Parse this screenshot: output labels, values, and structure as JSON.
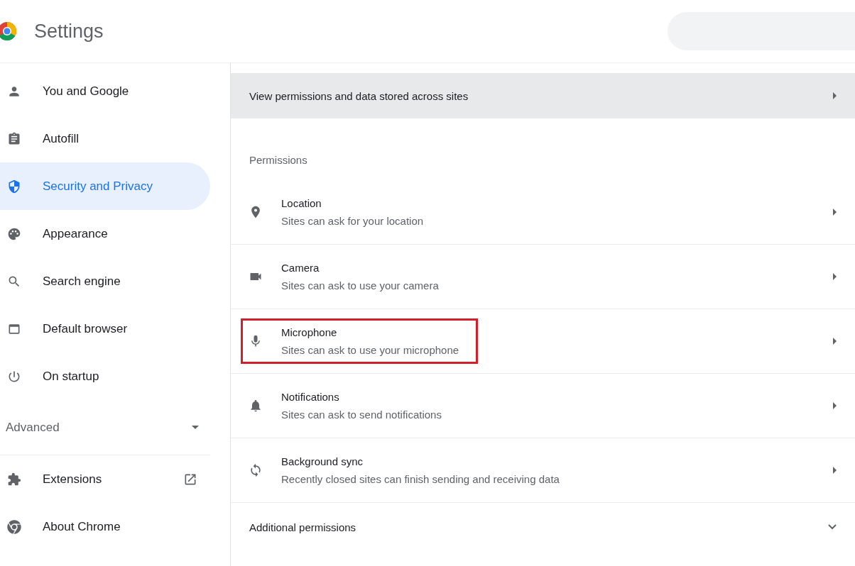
{
  "header": {
    "title": "Settings"
  },
  "sidebar": {
    "items": [
      {
        "label": "You and Google",
        "selected": false
      },
      {
        "label": "Autofill",
        "selected": false
      },
      {
        "label": "Security and Privacy",
        "selected": true
      },
      {
        "label": "Appearance",
        "selected": false
      },
      {
        "label": "Search engine",
        "selected": false
      },
      {
        "label": "Default browser",
        "selected": false
      },
      {
        "label": "On startup",
        "selected": false
      }
    ],
    "advanced": {
      "label": "Advanced",
      "expanded": false
    },
    "footer_items": [
      {
        "label": "Extensions",
        "external": true
      },
      {
        "label": "About Chrome",
        "external": false
      }
    ]
  },
  "content": {
    "site_data_link": "View permissions and data stored across sites",
    "permissions_heading": "Permissions",
    "permissions": [
      {
        "title": "Location",
        "description": "Sites can ask for your location",
        "highlighted": false
      },
      {
        "title": "Camera",
        "description": "Sites can ask to use your camera",
        "highlighted": false
      },
      {
        "title": "Microphone",
        "description": "Sites can ask to use your microphone",
        "highlighted": true
      },
      {
        "title": "Notifications",
        "description": "Sites can ask to send notifications",
        "highlighted": false
      },
      {
        "title": "Background sync",
        "description": "Recently closed sites can finish sending and receiving data",
        "highlighted": false
      }
    ],
    "additional": {
      "label": "Additional permissions",
      "expanded": false
    }
  }
}
